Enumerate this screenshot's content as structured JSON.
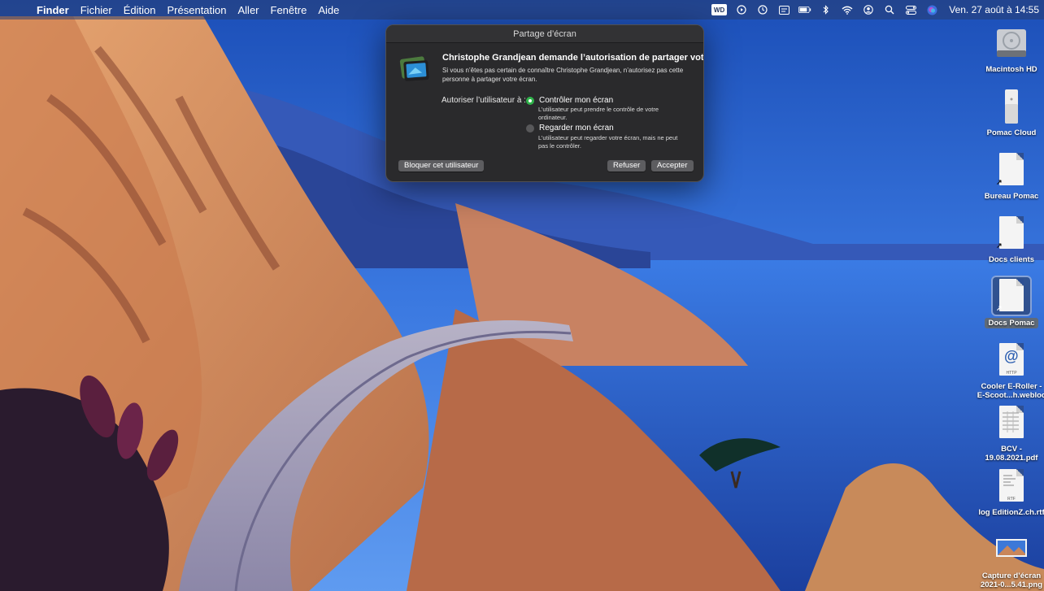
{
  "menubar": {
    "apple_glyph": "",
    "app_name": "Finder",
    "menus": [
      "Fichier",
      "Édition",
      "Présentation",
      "Aller",
      "Fenêtre",
      "Aide"
    ],
    "status_icons": [
      "wd-icon",
      "play-icon",
      "clock-icon",
      "calendar-icon",
      "battery-icon",
      "bluetooth-icon",
      "wifi-icon",
      "user-icon",
      "search-icon",
      "control-center-icon",
      "siri-icon"
    ],
    "wd_label": "WD",
    "clock": "Ven. 27 août à 14:55"
  },
  "dialog": {
    "title": "Partage d’écran",
    "heading": "Christophe Grandjean demande l’autorisation de partager votre écran.",
    "description": "Si vous n’êtes pas certain de connaître Christophe Grandjean, n’autorisez pas cette personne à partager votre écran.",
    "allow_label": "Autoriser l’utilisateur à :",
    "options": [
      {
        "label": "Contrôler mon écran",
        "description": "L’utilisateur peut prendre le contrôle de votre ordinateur.",
        "selected": true
      },
      {
        "label": "Regarder mon écran",
        "description": "L’utilisateur peut regarder votre écran, mais ne peut pas le contrôler.",
        "selected": false
      }
    ],
    "buttons": {
      "block": "Bloquer cet utilisateur",
      "refuse": "Refuser",
      "accept": "Accepter"
    }
  },
  "desktop": {
    "items": [
      {
        "label": "Macintosh HD",
        "icon": "hard-drive-icon"
      },
      {
        "label": "Pomac Cloud",
        "icon": "external-drive-icon"
      },
      {
        "label": "Bureau Pomac",
        "icon": "alias-document-icon"
      },
      {
        "label": "Docs clients",
        "icon": "alias-document-icon"
      },
      {
        "label": "Docs Pomac",
        "icon": "alias-document-icon",
        "selected": true
      },
      {
        "label_line1": "Cooler E-Roller -",
        "label_line2": "E-Scoot...h.webloc",
        "icon": "webloc-icon",
        "tag": "HTTP"
      },
      {
        "label_line1": "BCV -",
        "label_line2": "19.08.2021.pdf",
        "icon": "pdf-document-icon"
      },
      {
        "label": "log EditionZ.ch.rtf",
        "icon": "rtf-document-icon",
        "tag": "RTF"
      },
      {
        "label_line1": "Capture d’écran",
        "label_line2": "2021-0...5.41.png",
        "icon": "screenshot-thumbnail-icon"
      }
    ]
  }
}
